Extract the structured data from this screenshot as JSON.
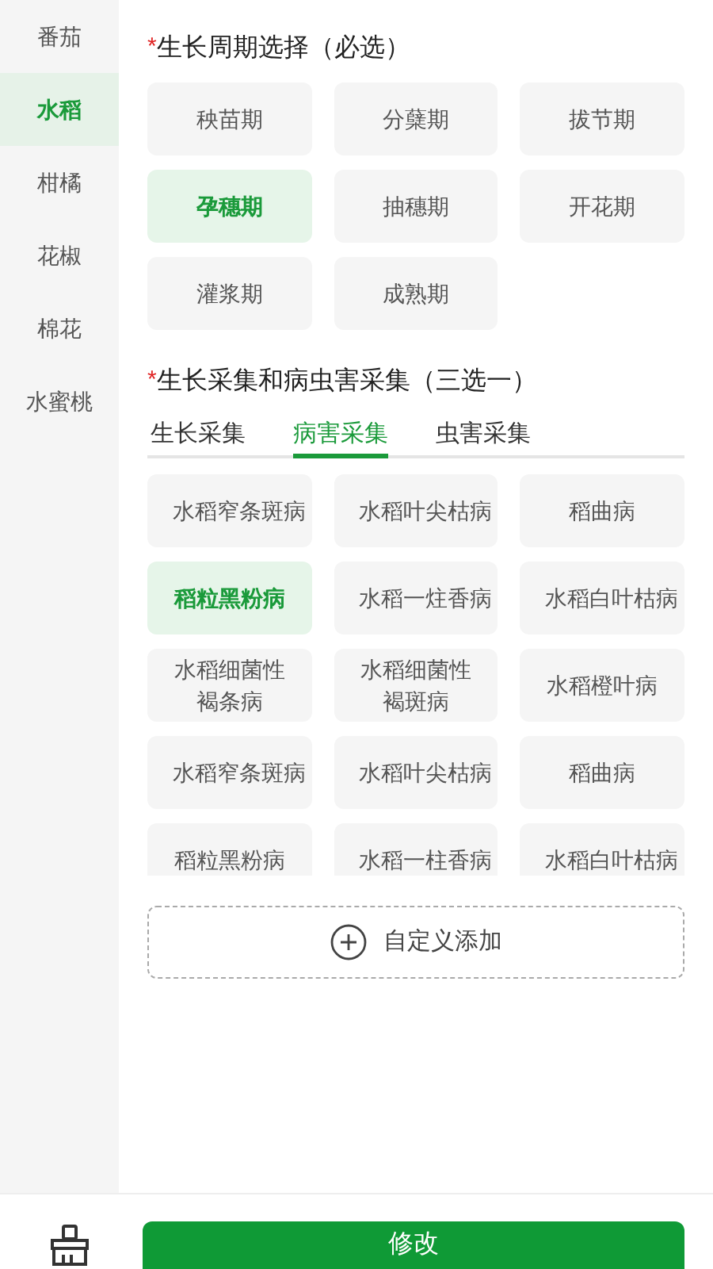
{
  "sidebar": {
    "items": [
      {
        "label": "番茄",
        "selected": false
      },
      {
        "label": "水稻",
        "selected": true
      },
      {
        "label": "柑橘",
        "selected": false
      },
      {
        "label": "花椒",
        "selected": false
      },
      {
        "label": "棉花",
        "selected": false
      },
      {
        "label": "水蜜桃",
        "selected": false
      }
    ]
  },
  "growth_stage": {
    "required_mark": "*",
    "title": "生长周期选择（必选）",
    "options": [
      {
        "label": "秧苗期",
        "selected": false
      },
      {
        "label": "分蘖期",
        "selected": false
      },
      {
        "label": "拔节期",
        "selected": false
      },
      {
        "label": "孕穗期",
        "selected": true
      },
      {
        "label": "抽穗期",
        "selected": false
      },
      {
        "label": "开花期",
        "selected": false
      },
      {
        "label": "灌浆期",
        "selected": false
      },
      {
        "label": "成熟期",
        "selected": false
      }
    ]
  },
  "collection": {
    "required_mark": "*",
    "title": "生长采集和病虫害采集（三选一）",
    "tabs": [
      {
        "label": "生长采集",
        "selected": false
      },
      {
        "label": "病害采集",
        "selected": true
      },
      {
        "label": "虫害采集",
        "selected": false
      }
    ],
    "options": [
      {
        "label": "水稻窄条斑病",
        "selected": false
      },
      {
        "label": "水稻叶尖枯病",
        "selected": false
      },
      {
        "label": "稻曲病",
        "selected": false
      },
      {
        "label": "稻粒黑粉病",
        "selected": true
      },
      {
        "label": "水稻一炷香病",
        "selected": false
      },
      {
        "label": "水稻白叶枯病",
        "selected": false
      },
      {
        "label": "水稻细菌性褐条病",
        "selected": false
      },
      {
        "label": "水稻细菌性褐斑病",
        "selected": false
      },
      {
        "label": "水稻橙叶病",
        "selected": false
      },
      {
        "label": "水稻窄条斑病",
        "selected": false
      },
      {
        "label": "水稻叶尖枯病",
        "selected": false
      },
      {
        "label": "稻曲病",
        "selected": false
      },
      {
        "label": "稻粒黑粉病",
        "selected": false
      },
      {
        "label": "水稻一柱香病",
        "selected": false
      },
      {
        "label": "水稻白叶枯病",
        "selected": false
      }
    ]
  },
  "custom_add": {
    "label": "自定义添加"
  },
  "bottom_bar": {
    "submit": {
      "label": "修改"
    }
  }
}
